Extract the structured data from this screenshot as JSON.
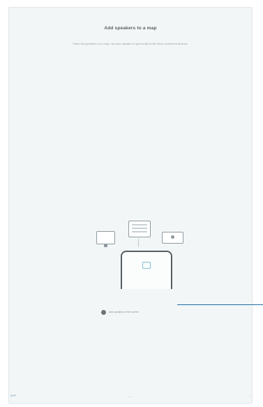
{
  "header": {
    "title": "Add speakers to a map",
    "subtitle": "Place the speakers on a map, use your speaker to give audio to the other connected devices."
  },
  "illustration": {
    "devices": [
      "monitor-icon",
      "tv-icon",
      "speaker-icon"
    ],
    "center_device": "phone-icon",
    "cast_icon": "cast-icon",
    "accent_color": "#7fc1d8"
  },
  "option": {
    "label": "Add speakers to the screen"
  },
  "nav": {
    "left_label": "SKIP",
    "center_label": "—",
    "right_label": "›"
  },
  "colors": {
    "background": "#f3f6f7",
    "callout": "#1c6fa4"
  }
}
